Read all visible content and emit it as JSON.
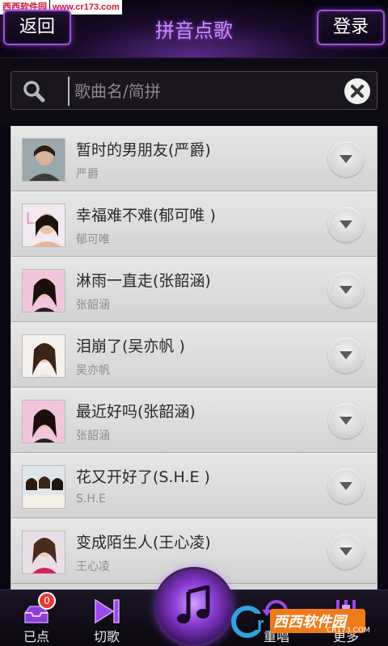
{
  "watermark": {
    "logo": "西西软件园",
    "url": "www.cr173.com"
  },
  "header": {
    "back_label": "返回",
    "title": "拼音点歌",
    "login_label": "登录"
  },
  "search": {
    "placeholder": "歌曲名/简拼",
    "value": ""
  },
  "songs": [
    {
      "title": "暂时的男朋友(严爵)",
      "artist": "严爵"
    },
    {
      "title": "幸福难不难(郁可唯 )",
      "artist": "郁可唯"
    },
    {
      "title": "淋雨一直走(张韶涵)",
      "artist": "张韶涵"
    },
    {
      "title": "泪崩了(吴亦帆 )",
      "artist": "吴亦帆"
    },
    {
      "title": "最近好吗(张韶涵)",
      "artist": "张韶涵"
    },
    {
      "title": "花又开好了(S.H.E )",
      "artist": "S.H.E"
    },
    {
      "title": "变成陌生人(王心凌)",
      "artist": "王心凌"
    }
  ],
  "bottom_bar": {
    "selected_label": "已点",
    "selected_count": "0",
    "skip_label": "切歌",
    "replay_label": "重唱",
    "more_label": "更多"
  },
  "overlay_logo": {
    "text": "西西软件园",
    "url": "CR173.COM"
  },
  "colors": {
    "accent": "#a14fe0",
    "title_purple": "#c98cff",
    "list_bg": "#d8d8d8"
  },
  "icons": [
    "search-icon",
    "clear-icon",
    "chevron-down-icon",
    "selected-songs-icon",
    "skip-icon",
    "music-note-icon",
    "replay-icon",
    "more-icon"
  ]
}
